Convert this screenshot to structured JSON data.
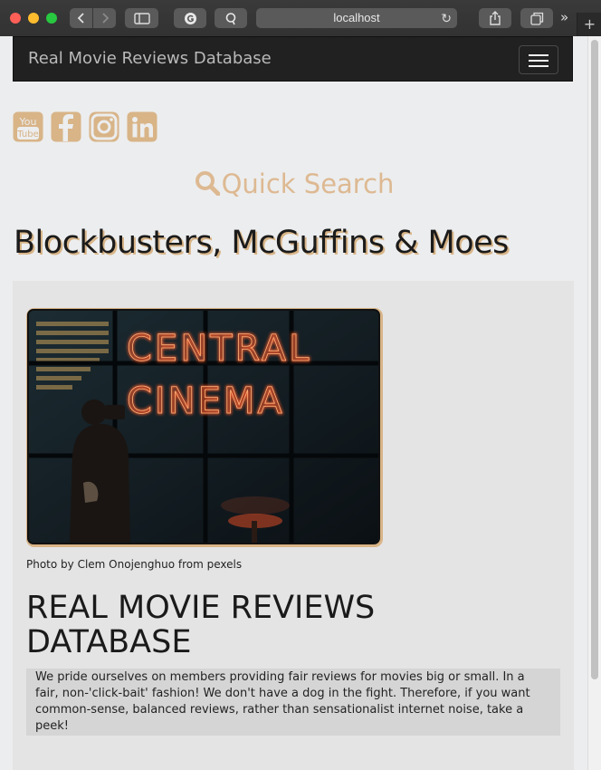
{
  "browser": {
    "url": "localhost"
  },
  "navbar": {
    "brand": "Real Movie Reviews Database"
  },
  "social": [
    {
      "icon": "youtube-icon"
    },
    {
      "icon": "facebook-icon"
    },
    {
      "icon": "instagram-icon"
    },
    {
      "icon": "linkedin-icon"
    }
  ],
  "search": {
    "label": "Quick Search"
  },
  "page": {
    "headline": "Blockbusters, McGuffins & Moes"
  },
  "feature": {
    "photo_sign_line1": "CENTRAL",
    "photo_sign_line2": "CINEMA",
    "caption": "Photo by Clem Onojenghuo from pexels",
    "title_line1": "REAL MOVIE REVIEWS",
    "title_line2": "DATABASE",
    "blurb": "We pride ourselves on members providing fair reviews for movies big or small. In a fair, non-'click-bait' fashion! We don't have a dog in the fight. Therefore, if you want common-sense, balanced reviews, rather than sensationalist internet noise, take a peek!"
  },
  "colors": {
    "accent": "#ddb992",
    "navbar_bg": "#212121",
    "page_bg": "#ecedee",
    "neon": "#ff5a2a"
  }
}
